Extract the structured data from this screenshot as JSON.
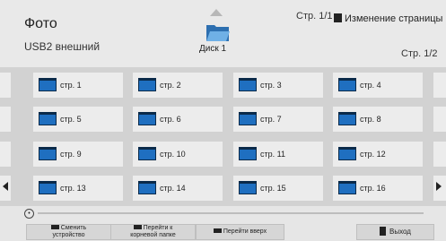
{
  "header": {
    "title": "Фото",
    "source": "USB2 внешний",
    "page_top": "Стр. 1/1",
    "change_page": "Изменение страницы",
    "disk_label": "Диск 1",
    "page_right": "Стр. 1/2"
  },
  "grid": {
    "items": [
      {
        "label": "стр. 1"
      },
      {
        "label": "стр. 2"
      },
      {
        "label": "стр. 3"
      },
      {
        "label": "стр. 4"
      },
      {
        "label": "стр. 5"
      },
      {
        "label": "стр. 6"
      },
      {
        "label": "стр. 7"
      },
      {
        "label": "стр. 8"
      },
      {
        "label": "стр. 9"
      },
      {
        "label": "стр. 10"
      },
      {
        "label": "стр. 11"
      },
      {
        "label": "стр. 12"
      },
      {
        "label": "стр. 13"
      },
      {
        "label": "стр. 14"
      },
      {
        "label": "стр. 15"
      },
      {
        "label": "стр. 16"
      }
    ]
  },
  "footer": {
    "change_device_l1": "Сменить",
    "change_device_l2": "устройство",
    "root_l1": "Перейти к",
    "root_l2": "корневой папке",
    "go_up": "Перейти вверх",
    "exit": "Выход"
  },
  "colors": {
    "folder_blue": "#1f6fc0",
    "folder_dark": "#0a2a4a",
    "background": "#e6e6e6"
  }
}
